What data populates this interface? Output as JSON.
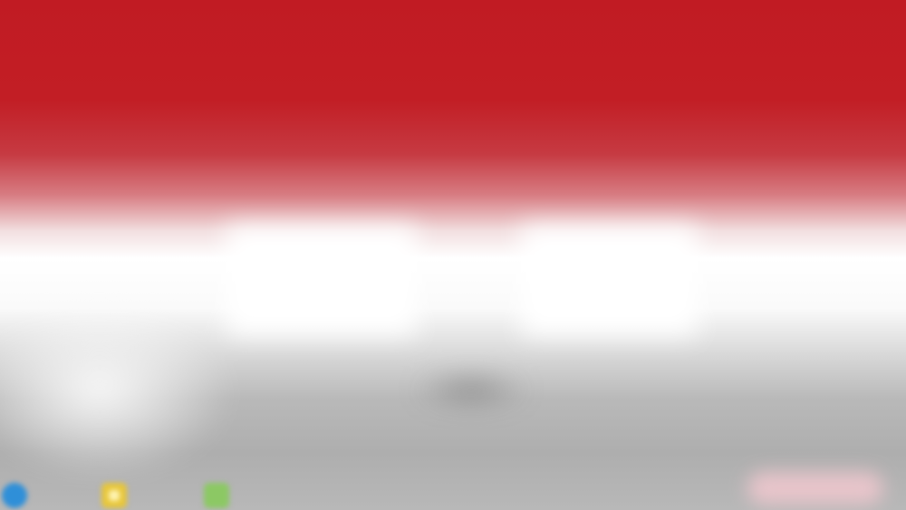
{
  "screen": {
    "content_state": "blurred"
  },
  "taskbar": {
    "icons": [
      "browser-icon",
      "file-manager-icon",
      "app-icon"
    ]
  },
  "colors": {
    "top_band": "#c11b23",
    "middle": "#ffffff",
    "bottom": "#b0b0b0",
    "browser_icon": "#2f8fd8",
    "file_manager_icon": "#e7c63a",
    "app_icon": "#8cc864",
    "tray": "#f2c8cf"
  }
}
